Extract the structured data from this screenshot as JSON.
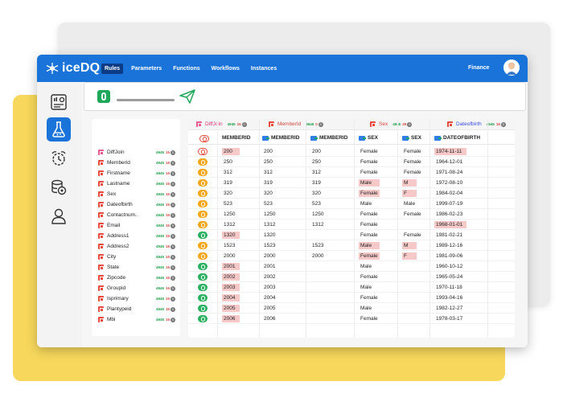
{
  "app": {
    "logo_text": "iceDQ",
    "nav": [
      "Rules",
      "Parameters",
      "Functions",
      "Workflows",
      "Instances"
    ],
    "active_nav": "Rules",
    "workspace": "Finance"
  },
  "sidebar": {
    "icons": [
      "dashboard-icon",
      "lab-flask-icon",
      "schedule-icon",
      "database-settings-icon",
      "user-icon"
    ],
    "active_icon": "lab-flask-icon"
  },
  "fields": [
    {
      "name": "DiffJoin",
      "matched": "4945",
      "diff": "15",
      "zero": "0",
      "icon_color": "#ea5a8e"
    },
    {
      "name": "Memberid",
      "matched": "4945",
      "diff": "15",
      "zero": "0",
      "icon_color": "#e94a3f"
    },
    {
      "name": "Firstname",
      "matched": "4945",
      "diff": "15",
      "zero": "0",
      "icon_color": "#e94a3f"
    },
    {
      "name": "Lastname",
      "matched": "4945",
      "diff": "15",
      "zero": "0",
      "icon_color": "#e94a3f"
    },
    {
      "name": "Sex",
      "matched": "4945",
      "diff": "15",
      "zero": "0",
      "icon_color": "#e94a3f"
    },
    {
      "name": "Dateofbirth",
      "matched": "4945",
      "diff": "15",
      "zero": "0",
      "icon_color": "#e94a3f"
    },
    {
      "name": "Contactnum..",
      "matched": "4945",
      "diff": "15",
      "zero": "0",
      "icon_color": "#e94a3f"
    },
    {
      "name": "Email",
      "matched": "4945",
      "diff": "15",
      "zero": "0",
      "icon_color": "#e94a3f"
    },
    {
      "name": "Address1",
      "matched": "4945",
      "diff": "15",
      "zero": "0",
      "icon_color": "#e94a3f"
    },
    {
      "name": "Address2",
      "matched": "4945",
      "diff": "15",
      "zero": "0",
      "icon_color": "#e94a3f"
    },
    {
      "name": "City",
      "matched": "4945",
      "diff": "15",
      "zero": "0",
      "icon_color": "#e94a3f"
    },
    {
      "name": "State",
      "matched": "4945",
      "diff": "15",
      "zero": "0",
      "icon_color": "#e94a3f"
    },
    {
      "name": "Zipcode",
      "matched": "4945",
      "diff": "15",
      "zero": "0",
      "icon_color": "#e94a3f"
    },
    {
      "name": "Groupid",
      "matched": "4945",
      "diff": "15",
      "zero": "0",
      "icon_color": "#e94a3f"
    },
    {
      "name": "Isprimary",
      "matched": "4945",
      "diff": "15",
      "zero": "0",
      "icon_color": "#e94a3f"
    },
    {
      "name": "Plantypeid",
      "matched": "4945",
      "diff": "15",
      "zero": "0",
      "icon_color": "#e94a3f"
    },
    {
      "name": "Mbi",
      "matched": "4945",
      "diff": "15",
      "zero": "0",
      "icon_color": "#e94a3f"
    }
  ],
  "groups": [
    {
      "title": "DiffJoin",
      "matched": "4945",
      "diff": "15",
      "zero": "0"
    },
    {
      "title": "MemberId",
      "matched": "4945",
      "diff": "0",
      "zero": "0"
    },
    {
      "title": "Sex",
      "matched": "4945",
      "diff": "29",
      "zero": "0"
    },
    {
      "title": "Dateofbirth",
      "matched": "4945",
      "diff": "15",
      "zero": "0"
    }
  ],
  "columns": [
    "MEMBERID",
    "MEMBERID",
    "MEMBERID",
    "SEX",
    "SEX",
    "DATEOFBIRTH"
  ],
  "rows": [
    {
      "status": "red",
      "m1": "200",
      "m1_hl": true,
      "m2": "200",
      "m3": "200",
      "s1": "Female",
      "s1_hl": false,
      "s2": "Female",
      "s2_hl": false,
      "dob": "1974-11-11",
      "dob_hl": true
    },
    {
      "status": "orange",
      "m1": "250",
      "m1_hl": false,
      "m2": "250",
      "m3": "250",
      "s1": "Female",
      "s1_hl": false,
      "s2": "Female",
      "s2_hl": false,
      "dob": "1964-12-01",
      "dob_hl": false
    },
    {
      "status": "orange",
      "m1": "312",
      "m1_hl": false,
      "m2": "312",
      "m3": "312",
      "s1": "Female",
      "s1_hl": false,
      "s2": "Female",
      "s2_hl": false,
      "dob": "1971-08-24",
      "dob_hl": false
    },
    {
      "status": "orange",
      "m1": "319",
      "m1_hl": false,
      "m2": "319",
      "m3": "319",
      "s1": "Male",
      "s1_hl": true,
      "s2": "M",
      "s2_hl": true,
      "dob": "1972-08-10",
      "dob_hl": false
    },
    {
      "status": "orange",
      "m1": "320",
      "m1_hl": false,
      "m2": "320",
      "m3": "320",
      "s1": "Female",
      "s1_hl": true,
      "s2": "F",
      "s2_hl": true,
      "dob": "1984-02-04",
      "dob_hl": false
    },
    {
      "status": "orange",
      "m1": "523",
      "m1_hl": false,
      "m2": "523",
      "m3": "523",
      "s1": "Male",
      "s1_hl": false,
      "s2": "Male",
      "s2_hl": false,
      "dob": "1999-07-19",
      "dob_hl": false
    },
    {
      "status": "orange",
      "m1": "1250",
      "m1_hl": false,
      "m2": "1250",
      "m3": "1250",
      "s1": "Female",
      "s1_hl": false,
      "s2": "Female",
      "s2_hl": false,
      "dob": "1986-02-23",
      "dob_hl": false
    },
    {
      "status": "orange",
      "m1": "1312",
      "m1_hl": false,
      "m2": "1312",
      "m3": "1312",
      "s1": "Female",
      "s1_hl": false,
      "s2": "",
      "s2_hl": false,
      "dob": "1968-01-01",
      "dob_hl": true
    },
    {
      "status": "green",
      "m1": "1320",
      "m1_hl": true,
      "m2": "1320",
      "m3": "",
      "s1": "Female",
      "s1_hl": false,
      "s2": "Female",
      "s2_hl": false,
      "dob": "1981-02-21",
      "dob_hl": false
    },
    {
      "status": "orange",
      "m1": "1523",
      "m1_hl": false,
      "m2": "1523",
      "m3": "1523",
      "s1": "Male",
      "s1_hl": true,
      "s2": "M",
      "s2_hl": true,
      "dob": "1989-12-16",
      "dob_hl": false
    },
    {
      "status": "orange",
      "m1": "2000",
      "m1_hl": false,
      "m2": "2000",
      "m3": "2000",
      "s1": "Female",
      "s1_hl": true,
      "s2": "F",
      "s2_hl": true,
      "dob": "1981-09-06",
      "dob_hl": false
    },
    {
      "status": "green",
      "m1": "2001",
      "m1_hl": true,
      "m2": "2001",
      "m3": "",
      "s1": "Male",
      "s1_hl": false,
      "s2": "",
      "s2_hl": false,
      "dob": "1960-10-12",
      "dob_hl": false
    },
    {
      "status": "green",
      "m1": "2002",
      "m1_hl": true,
      "m2": "2002",
      "m3": "",
      "s1": "Female",
      "s1_hl": false,
      "s2": "",
      "s2_hl": false,
      "dob": "1965-05-24",
      "dob_hl": false
    },
    {
      "status": "green",
      "m1": "2003",
      "m1_hl": true,
      "m2": "2003",
      "m3": "",
      "s1": "Male",
      "s1_hl": false,
      "s2": "",
      "s2_hl": false,
      "dob": "1970-11-18",
      "dob_hl": false
    },
    {
      "status": "green",
      "m1": "2004",
      "m1_hl": true,
      "m2": "2004",
      "m3": "",
      "s1": "Female",
      "s1_hl": false,
      "s2": "",
      "s2_hl": false,
      "dob": "1993-04-16",
      "dob_hl": false
    },
    {
      "status": "green",
      "m1": "2005",
      "m1_hl": true,
      "m2": "2005",
      "m3": "",
      "s1": "Male",
      "s1_hl": false,
      "s2": "",
      "s2_hl": false,
      "dob": "1982-12-27",
      "dob_hl": false
    },
    {
      "status": "green",
      "m1": "2006",
      "m1_hl": true,
      "m2": "2006",
      "m3": "",
      "s1": "Female",
      "s1_hl": false,
      "s2": "",
      "s2_hl": false,
      "dob": "1978-03-17",
      "dob_hl": false
    }
  ],
  "colors": {
    "brand_blue": "#1a73d9",
    "nav_active": "#0c3c86",
    "highlight": "#f6c9c9",
    "match_green": "#2bb061",
    "partial_orange": "#f3a619",
    "missing_red": "#e94a3f",
    "backdrop_yellow": "#f7d85c",
    "backdrop_gray": "#ececec"
  }
}
